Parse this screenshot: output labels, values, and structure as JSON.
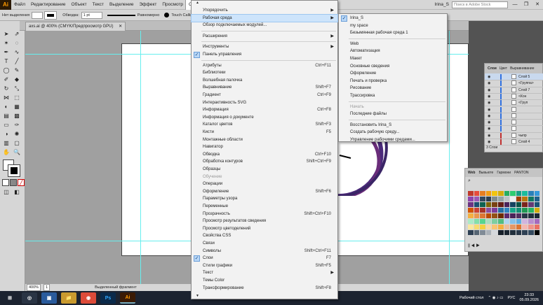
{
  "menubar": {
    "logo": "Ai",
    "items": [
      "Файл",
      "Редактирование",
      "Объект",
      "Текст",
      "Выделение",
      "Эффект",
      "Просмотр",
      "Окно",
      "Справка"
    ],
    "active_index": 7,
    "user": "Irina_S",
    "search_placeholder": "Поиск в Adobe Stock",
    "win_buttons": [
      "—",
      "❐",
      "✕"
    ]
  },
  "controlbar": {
    "selection": "Нет выделения",
    "stroke_label": "Обводка:",
    "stroke_value": "1 pt",
    "stroke_style": "Равномерно",
    "brush": "Touch Callig...",
    "icons": [
      "fill-swatch",
      "stroke-swatch",
      "brush-dot"
    ]
  },
  "document": {
    "tab_title": "axs.ai @ 400% (CMYK/Предпросмотр GPU)",
    "close": "✕"
  },
  "statusbar": {
    "zoom": "400%",
    "page": "1",
    "status": "Выделенный фрагмент"
  },
  "okno_menu": {
    "top_arrow": "▲",
    "bottom_arrow": "▼",
    "items": [
      {
        "label": "Упорядочить",
        "arrow": true
      },
      {
        "label": "Рабочая среда",
        "arrow": true,
        "highlight": true
      },
      {
        "label": "Обзор подключаемых модулей..."
      },
      {
        "sep": true
      },
      {
        "label": "Расширения",
        "arrow": true
      },
      {
        "sep": true
      },
      {
        "label": "Инструменты",
        "arrow": true
      },
      {
        "label": "Панель управления",
        "check": true
      },
      {
        "sep": true
      },
      {
        "label": "Атрибуты",
        "sc": "Ctrl+F11"
      },
      {
        "label": "Библиотеки"
      },
      {
        "label": "Волшебная палочка"
      },
      {
        "label": "Выравнивание",
        "sc": "Shift+F7"
      },
      {
        "label": "Градиент",
        "sc": "Ctrl+F9"
      },
      {
        "label": "Интерактивность SVG"
      },
      {
        "label": "Информация",
        "sc": "Ctrl+F8"
      },
      {
        "label": "Информация о документе"
      },
      {
        "label": "Каталог цветов",
        "sc": "Shift+F3"
      },
      {
        "label": "Кисти",
        "sc": "F5"
      },
      {
        "label": "Монтажные области"
      },
      {
        "label": "Навигатор"
      },
      {
        "label": "Обводка",
        "sc": "Ctrl+F10"
      },
      {
        "label": "Обработка контуров",
        "sc": "Shift+Ctrl+F9"
      },
      {
        "label": "Образцы"
      },
      {
        "label": "Обучение",
        "disabled": true
      },
      {
        "label": "Операции"
      },
      {
        "label": "Оформление",
        "sc": "Shift+F6"
      },
      {
        "label": "Параметры узора"
      },
      {
        "label": "Переменные"
      },
      {
        "label": "Прозрачность",
        "sc": "Shift+Ctrl+F10"
      },
      {
        "label": "Просмотр результатов сведения"
      },
      {
        "label": "Просмотр цветоделений"
      },
      {
        "label": "Свойства CSS"
      },
      {
        "label": "Связи"
      },
      {
        "label": "Символы",
        "sc": "Shift+Ctrl+F11"
      },
      {
        "label": "Слои",
        "sc": "F7",
        "check": true
      },
      {
        "label": "Стили графики",
        "sc": "Shift+F5"
      },
      {
        "label": "Текст",
        "arrow": true
      },
      {
        "label": "Темы Color"
      },
      {
        "label": "Трансформирование",
        "sc": "Shift+F8"
      }
    ]
  },
  "workspace_menu": {
    "items": [
      {
        "label": "Irina_S",
        "check": true
      },
      {
        "label": "my space"
      },
      {
        "label": "Безымянная рабочая среда 1"
      },
      {
        "sep": true
      },
      {
        "label": "Web"
      },
      {
        "label": "Автоматизация"
      },
      {
        "label": "Макет"
      },
      {
        "label": "Основные сведения"
      },
      {
        "label": "Оформление"
      },
      {
        "label": "Печать и проверка"
      },
      {
        "label": "Рисование"
      },
      {
        "label": "Трассировка"
      },
      {
        "sep": true
      },
      {
        "label": "Начать",
        "disabled": true
      },
      {
        "label": "Последние файлы"
      },
      {
        "sep": true
      },
      {
        "label": "Восстановить Irina_S"
      },
      {
        "label": "Создать рабочую среду..."
      },
      {
        "label": "Управление рабочими средами..."
      }
    ]
  },
  "layers_panel": {
    "tabs": [
      "Слои",
      "Цвет",
      "Выравнивание"
    ],
    "rows": [
      "Слой 5",
      "<Группа>",
      "Слой 7",
      "<Кон",
      "<Груп",
      "",
      "",
      "",
      "",
      "чыпр",
      "Слой 4"
    ],
    "footer": "3 Слои"
  },
  "swatches_panel": {
    "tabs": [
      "Web",
      "Вывьюте",
      "Гармони",
      "PANTON"
    ],
    "colors": [
      "#c0392b",
      "#e74c3c",
      "#e67e22",
      "#f39c12",
      "#f1c40f",
      "#d4ac0d",
      "#27ae60",
      "#2ecc71",
      "#16a085",
      "#1abc9c",
      "#2980b9",
      "#3498db",
      "#8e44ad",
      "#9b59b6",
      "#34495e",
      "#2c3e50",
      "#7f8c8d",
      "#95a5a6",
      "#bdc3c7",
      "#ecf0f1",
      "#a04000",
      "#b9770e",
      "#117864",
      "#1f618d",
      "#6c3483",
      "#1b4f72",
      "#0e6251",
      "#7d6608",
      "#784212",
      "#641e16",
      "#4a235a",
      "#154360",
      "#0b5345",
      "#7b241c",
      "#633974",
      "#1a5276",
      "#d35400",
      "#cb4335",
      "#a93226",
      "#884ea0",
      "#7d3c98",
      "#2471a3",
      "#2e86c1",
      "#17a589",
      "#138d75",
      "#229954",
      "#28b463",
      "#d4ac0d",
      "#f5b041",
      "#eb984e",
      "#dc7633",
      "#ba4a00",
      "#935116",
      "#6e2c00",
      "#5b2c6f",
      "#4a235a",
      "#512e5f",
      "#283747",
      "#212f3d",
      "#1c2833",
      "#abebc6",
      "#82e0aa",
      "#58d68d",
      "#a9dfbf",
      "#7dcea0",
      "#52be80",
      "#aed6f1",
      "#85c1e9",
      "#5dade2",
      "#d2b4de",
      "#bb8fce",
      "#a569bd",
      "#f9e79f",
      "#f7dc6f",
      "#f4d03f",
      "#fad7a0",
      "#f8c471",
      "#f5b041",
      "#edbb99",
      "#e59866",
      "#dc7633",
      "#f5b7b1",
      "#f1948a",
      "#ec7063",
      "#2e4053",
      "#566573",
      "#808b96",
      "#abb2b9",
      "#d5d8dc",
      "#17202a",
      "#1b2631",
      "#212f3c",
      "#283747",
      "#2e4053",
      "#34495e",
      "#000000"
    ]
  },
  "taskbar": {
    "apps": [
      "⊞",
      "◎",
      "▣",
      "📁",
      "◉",
      "Ps",
      "Ai"
    ],
    "lang": "РУС",
    "desktop": "Рабочий стол",
    "time": "23:33",
    "date": "05.09.2026"
  }
}
